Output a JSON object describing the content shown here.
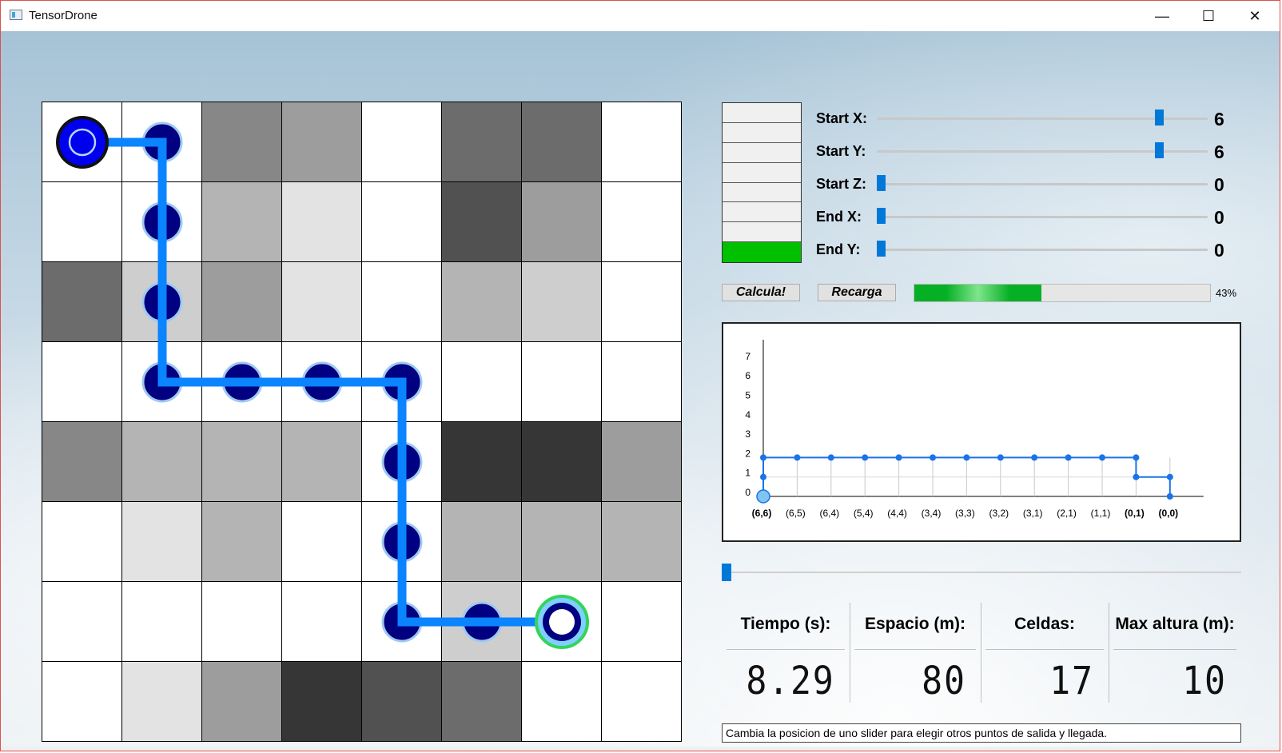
{
  "window": {
    "title": "TensorDrone",
    "minimize": "—",
    "maximize": "☐",
    "close": "✕"
  },
  "grid": {
    "cells": [
      [
        "#ffffff",
        "#ffffff",
        "#878787",
        "#9d9d9d",
        "#ffffff",
        "#6c6c6c",
        "#6c6c6c",
        "#ffffff"
      ],
      [
        "#ffffff",
        "#ffffff",
        "#b4b4b4",
        "#e3e3e3",
        "#ffffff",
        "#515151",
        "#9d9d9d",
        "#ffffff"
      ],
      [
        "#6c6c6c",
        "#cecece",
        "#9d9d9d",
        "#e3e3e3",
        "#ffffff",
        "#b4b4b4",
        "#cecece",
        "#ffffff"
      ],
      [
        "#ffffff",
        "#ffffff",
        "#ffffff",
        "#ffffff",
        "#ffffff",
        "#ffffff",
        "#ffffff",
        "#ffffff"
      ],
      [
        "#878787",
        "#b4b4b4",
        "#b4b4b4",
        "#b4b4b4",
        "#ffffff",
        "#363636",
        "#363636",
        "#9d9d9d"
      ],
      [
        "#ffffff",
        "#e3e3e3",
        "#b4b4b4",
        "#ffffff",
        "#ffffff",
        "#b4b4b4",
        "#b4b4b4",
        "#b4b4b4"
      ],
      [
        "#ffffff",
        "#ffffff",
        "#ffffff",
        "#ffffff",
        "#ffffff",
        "#cecece",
        "#ffffff",
        "#ffffff"
      ],
      [
        "#ffffff",
        "#e3e3e3",
        "#9d9d9d",
        "#363636",
        "#515151",
        "#6c6c6c",
        "#ffffff",
        "#ffffff"
      ]
    ],
    "route": [
      [
        0,
        0
      ],
      [
        1,
        0
      ],
      [
        1,
        1
      ],
      [
        1,
        2
      ],
      [
        1,
        3
      ],
      [
        2,
        3
      ],
      [
        3,
        3
      ],
      [
        4,
        3
      ],
      [
        4,
        4
      ],
      [
        4,
        5
      ],
      [
        4,
        6
      ],
      [
        5,
        6
      ],
      [
        6,
        6
      ]
    ],
    "path_color": "#0a84ff",
    "node_color": "#000080"
  },
  "levels": {
    "total": 8,
    "active_index": 7,
    "active_color": "#00c000"
  },
  "sliders": [
    {
      "label": "Start X:",
      "value": "6",
      "fraction": 0.84
    },
    {
      "label": "Start Y:",
      "value": "6",
      "fraction": 0.84
    },
    {
      "label": "Start Z:",
      "value": "0",
      "fraction": 0.0
    },
    {
      "label": "End X:",
      "value": "0",
      "fraction": 0.0
    },
    {
      "label": "End Y:",
      "value": "0",
      "fraction": 0.0
    }
  ],
  "buttons": {
    "calc": "Calcula!",
    "reload": "Recarga"
  },
  "progress": {
    "percent": 43,
    "text": "43%"
  },
  "chart_data": {
    "type": "line",
    "categories": [
      "(6,6)",
      "(6,5)",
      "(6,4)",
      "(5,4)",
      "(4,4)",
      "(3,4)",
      "(3,3)",
      "(3,2)",
      "(3,1)",
      "(2,1)",
      "(1,1)",
      "(0,1)",
      "(0,0)"
    ],
    "bold_categories": [
      "(6,6)",
      "(0,1)",
      "(0,0)"
    ],
    "points": [
      {
        "x": 0,
        "y": 0
      },
      {
        "x": 0,
        "y": 1
      },
      {
        "x": 0,
        "y": 2
      },
      {
        "x": 1,
        "y": 2
      },
      {
        "x": 2,
        "y": 2
      },
      {
        "x": 3,
        "y": 2
      },
      {
        "x": 4,
        "y": 2
      },
      {
        "x": 5,
        "y": 2
      },
      {
        "x": 6,
        "y": 2
      },
      {
        "x": 7,
        "y": 2
      },
      {
        "x": 8,
        "y": 2
      },
      {
        "x": 9,
        "y": 2
      },
      {
        "x": 10,
        "y": 2
      },
      {
        "x": 11,
        "y": 2
      },
      {
        "x": 11,
        "y": 1
      },
      {
        "x": 12,
        "y": 1
      },
      {
        "x": 12,
        "y": 0
      }
    ],
    "ylim": [
      0,
      7
    ],
    "yticks": [
      "0",
      "1",
      "2",
      "3",
      "4",
      "5",
      "6",
      "7"
    ],
    "line_color": "#1a73e8",
    "title": "",
    "xlabel": "",
    "ylabel": ""
  },
  "timeline": {
    "fraction": 0.0
  },
  "stats": [
    {
      "label": "Tiempo (s):",
      "value": "8.29"
    },
    {
      "label": "Espacio (m):",
      "value": "80"
    },
    {
      "label": "Celdas:",
      "value": "17"
    },
    {
      "label": "Max altura (m):",
      "value": "10"
    }
  ],
  "status": "Cambia la posicion de uno slider para elegir otros puntos de salida y llegada."
}
